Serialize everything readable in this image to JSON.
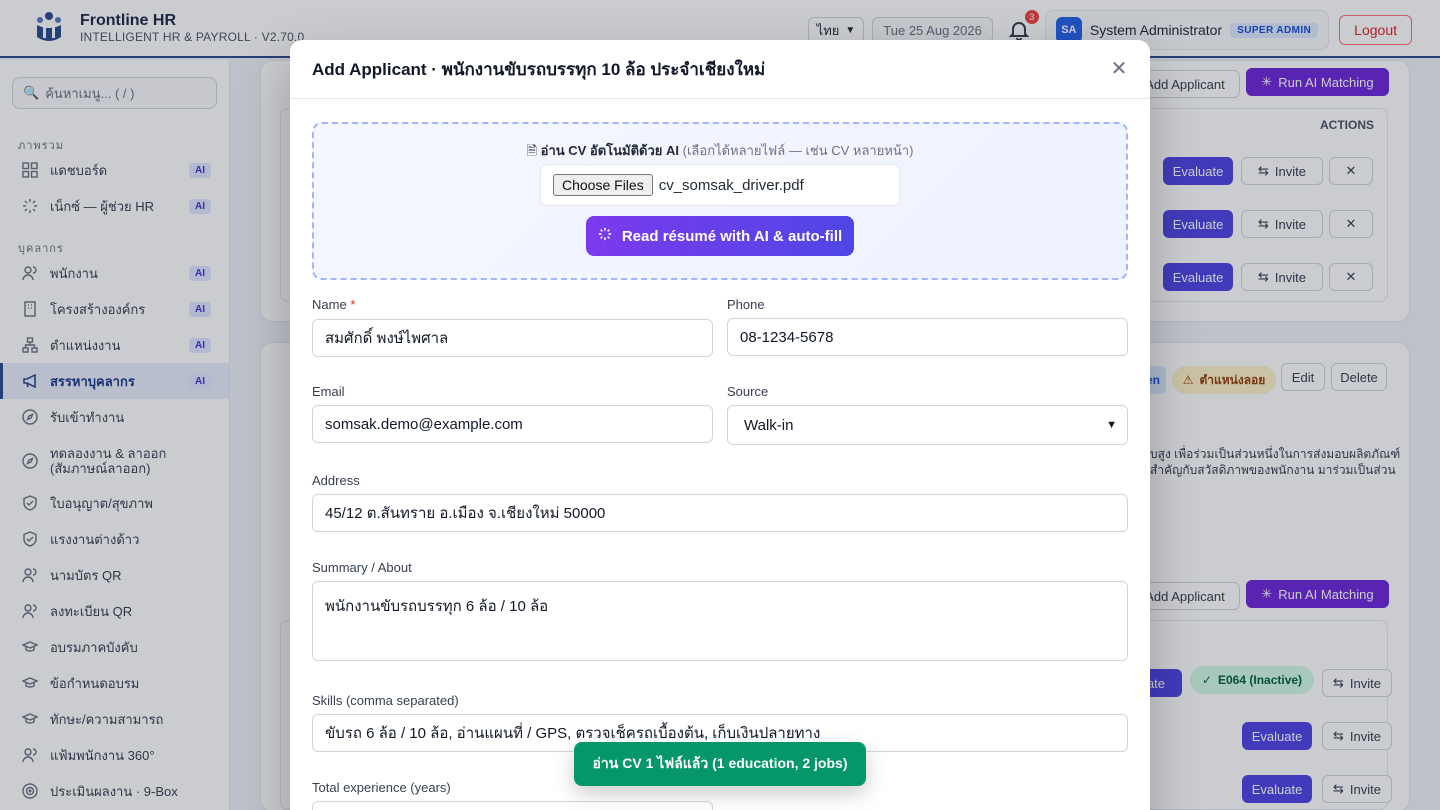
{
  "app": {
    "name": "Frontline HR",
    "subtitle": "INTELLIGENT HR & PAYROLL · V2.70.0",
    "language": "ไทย",
    "date": "Tue 25 Aug 2026",
    "notifications": "3",
    "user_initials": "SA",
    "user_name": "System Administrator",
    "user_role": "SUPER ADMIN",
    "logout_label": "Logout"
  },
  "sidebar": {
    "search_placeholder": "ค้นหาเมนู... ( / )",
    "sections": [
      "ภาพรวม",
      "บุคลากร"
    ],
    "items": [
      {
        "label": "แดชบอร์ด",
        "ai": "AI"
      },
      {
        "label": "เน็กซ์ — ผู้ช่วย HR",
        "ai": "AI"
      },
      {
        "label": "พนักงาน",
        "ai": "AI"
      },
      {
        "label": "โครงสร้างองค์กร",
        "ai": "AI"
      },
      {
        "label": "ตำแหน่งงาน",
        "ai": "AI"
      },
      {
        "label": "สรรหาบุคลากร",
        "ai": "AI"
      },
      {
        "label": "รับเข้าทำงาน",
        "ai": ""
      },
      {
        "label": "ทดลองงาน & ลาออก (สัมภาษณ์ลาออก)",
        "ai": ""
      },
      {
        "label": "ใบอนุญาต/สุขภาพ",
        "ai": ""
      },
      {
        "label": "แรงงานต่างด้าว",
        "ai": ""
      },
      {
        "label": "นามบัตร QR",
        "ai": ""
      },
      {
        "label": "ลงทะเบียน QR",
        "ai": ""
      },
      {
        "label": "อบรมภาคบังคับ",
        "ai": ""
      },
      {
        "label": "ข้อกำหนดอบรม",
        "ai": ""
      },
      {
        "label": "ทักษะ/ความสามารถ",
        "ai": ""
      },
      {
        "label": "แฟ้มพนักงาน 360°",
        "ai": ""
      },
      {
        "label": "ประเมินผลงาน · 9-Box",
        "ai": ""
      }
    ]
  },
  "background": {
    "add_applicant": "Add Applicant",
    "run_ai_matching": "Run AI Matching",
    "actions_header": "ACTIONS",
    "evaluate": "Evaluate",
    "invite": "Invite",
    "edit": "Edit",
    "delete": "Delete",
    "position_badge": "ตำแหน่งลอย",
    "open_badge": "en",
    "employee_badge": "E064 (Inactive)",
    "desc_line1": "บสูง เพื่อร่วมเป็นส่วนหนึ่งในการส่งมอบผลิตภัณฑ์",
    "desc_line2": "สำคัญกับสวัสดิภาพของพนักงาน มาร่วมเป็นส่วน"
  },
  "modal": {
    "title": "Add Applicant · พนักงานขับรถบรรทุก 10 ล้อ ประจำเชียงใหม่",
    "cv_label_bold": "อ่าน CV อัตโนมัติด้วย AI",
    "cv_label_hint": "(เลือกได้หลายไฟล์ — เช่น CV หลายหน้า)",
    "choose_files": "Choose Files",
    "file_name": "cv_somsak_driver.pdf",
    "ai_read_button": "Read résumé with AI & auto-fill",
    "fields": {
      "name_label": "Name",
      "name_value": "สมศักดิ์ พงษ์ไพศาล",
      "phone_label": "Phone",
      "phone_value": "08-1234-5678",
      "email_label": "Email",
      "email_value": "somsak.demo@example.com",
      "source_label": "Source",
      "source_value": "Walk-in",
      "address_label": "Address",
      "address_value": "45/12 ต.สันทราย อ.เมือง จ.เชียงใหม่ 50000",
      "summary_label": "Summary / About",
      "summary_value": "พนักงานขับรถบรรทุก 6 ล้อ / 10 ล้อ",
      "skills_label": "Skills (comma separated)",
      "skills_value": "ขับรถ 6 ล้อ / 10 ล้อ, อ่านแผนที่ / GPS, ตรวจเช็ครถเบื้องต้น, เก็บเงินปลายทาง",
      "experience_label": "Total experience (years)"
    }
  },
  "toast": {
    "message": "อ่าน CV 1 ไฟล์แล้ว (1 education, 2 jobs)"
  },
  "colors": {
    "brand": "#2b4c8c",
    "primary": "#4f46e5",
    "violet": "#6d28d9",
    "success": "#059669",
    "danger": "#dc2626"
  }
}
